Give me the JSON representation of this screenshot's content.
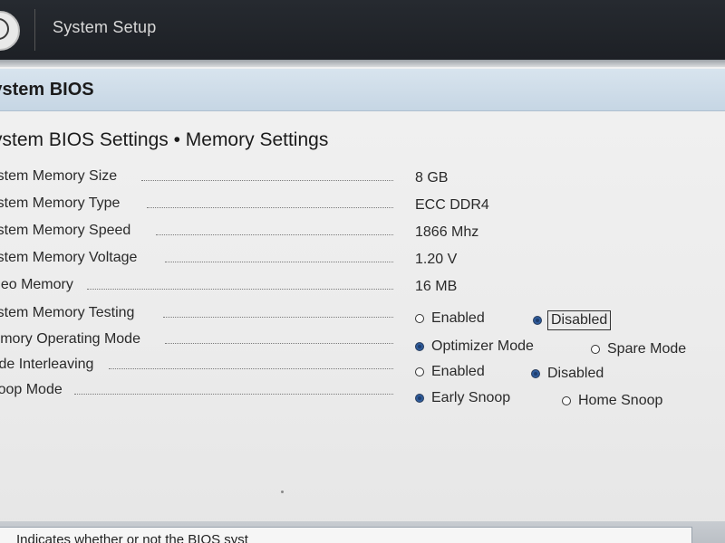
{
  "header": {
    "app_title": "System Setup"
  },
  "section": {
    "title": "System BIOS"
  },
  "page": {
    "title": "System BIOS Settings • Memory Settings"
  },
  "info_rows": [
    {
      "label": "System Memory Size",
      "value": "8 GB"
    },
    {
      "label": "System Memory Type",
      "value": "ECC DDR4"
    },
    {
      "label": "System Memory Speed",
      "value": "1866 Mhz"
    },
    {
      "label": "System Memory Voltage",
      "value": "1.20 V"
    },
    {
      "label": "Video Memory",
      "value": "16 MB"
    }
  ],
  "option_rows": [
    {
      "label": "System Memory Testing",
      "options": [
        "Enabled",
        "Disabled"
      ],
      "selected": "Disabled"
    },
    {
      "label": "Memory Operating Mode",
      "options": [
        "Optimizer Mode",
        "Spare Mode"
      ],
      "selected": "Optimizer Mode"
    },
    {
      "label": "Node Interleaving",
      "options": [
        "Enabled",
        "Disabled"
      ],
      "selected": "Disabled"
    },
    {
      "label": "Snoop Mode",
      "options": [
        "Early Snoop",
        "Home Snoop"
      ],
      "selected": "Early Snoop"
    }
  ],
  "help": {
    "text": "Indicates whether or not the BIOS syst"
  },
  "colors": {
    "topbar": "#1d2025",
    "section_bar": "#c6d6e4",
    "background": "#ececec",
    "radio_selected": "#2e5b9a"
  }
}
